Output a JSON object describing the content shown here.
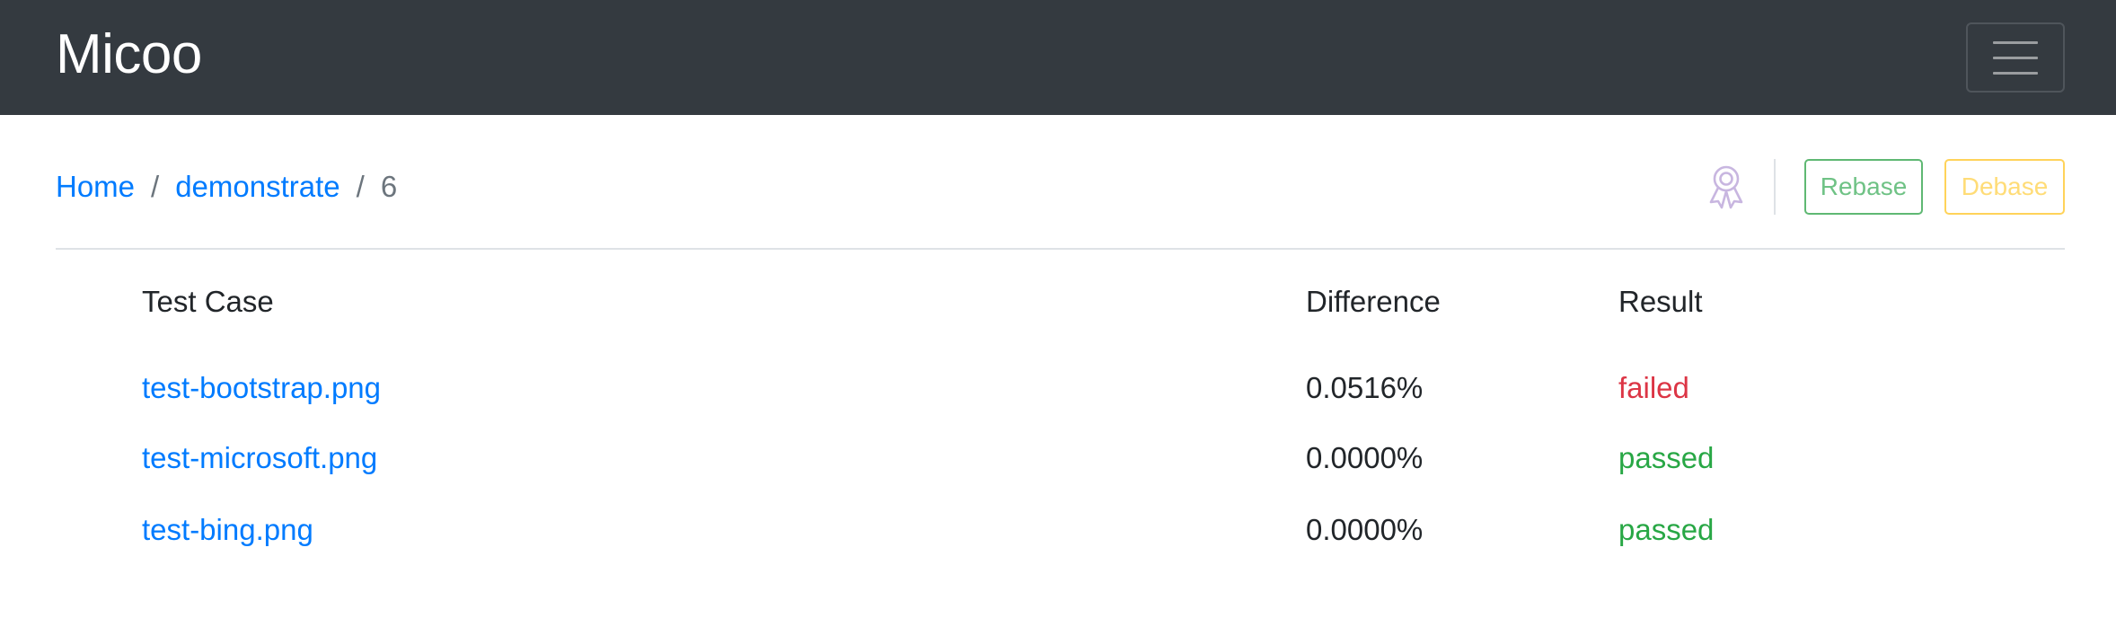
{
  "app": {
    "brand": "Micoo"
  },
  "breadcrumb": {
    "home": "Home",
    "project": "demonstrate",
    "build": "6",
    "separator": "/"
  },
  "actions": {
    "rebase_label": "Rebase",
    "debase_label": "Debase"
  },
  "table": {
    "headers": [
      "Test Case",
      "Difference",
      "Result"
    ],
    "rows": [
      {
        "case": "test-bootstrap.png",
        "difference": "0.0516%",
        "result": "failed"
      },
      {
        "case": "test-microsoft.png",
        "difference": "0.0000%",
        "result": "passed"
      },
      {
        "case": "test-bing.png",
        "difference": "0.0000%",
        "result": "passed"
      }
    ]
  },
  "colors": {
    "navbar": "#343a40",
    "link": "#007bff",
    "failed": "#dc3545",
    "passed": "#28a745",
    "rebase": "#28a745",
    "debase": "#ffc107",
    "award_icon": "#c8b6e0"
  },
  "icons": {
    "menu": "hamburger-icon",
    "award": "award-ribbon-icon"
  }
}
